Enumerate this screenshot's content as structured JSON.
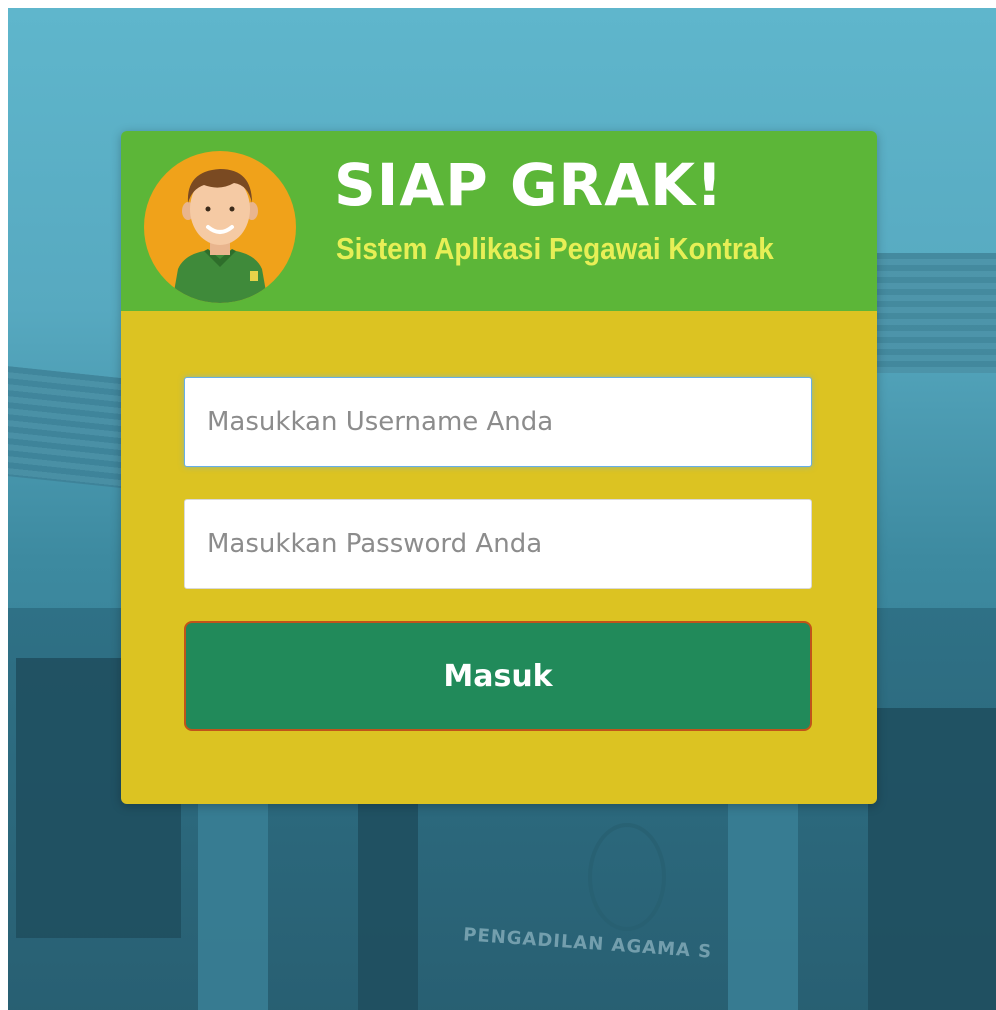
{
  "app": {
    "title": "SIAP GRAK!",
    "subtitle": "Sistem Aplikasi Pegawai Kontrak"
  },
  "login": {
    "username_placeholder": "Masukkan Username Anda",
    "username_value": "",
    "password_placeholder": "Masukkan Password Anda",
    "password_value": "",
    "submit_label": "Masuk"
  },
  "background": {
    "sign_text": "PENGADILAN AGAMA S"
  },
  "colors": {
    "header_green": "#5cb638",
    "body_yellow": "#dcc322",
    "button_green": "#218a5a",
    "title_white": "#ffffff",
    "subtitle_yellow": "#e7ef56",
    "avatar_orange": "#f0a21a"
  },
  "icons": {
    "avatar": "employee-avatar-icon"
  }
}
